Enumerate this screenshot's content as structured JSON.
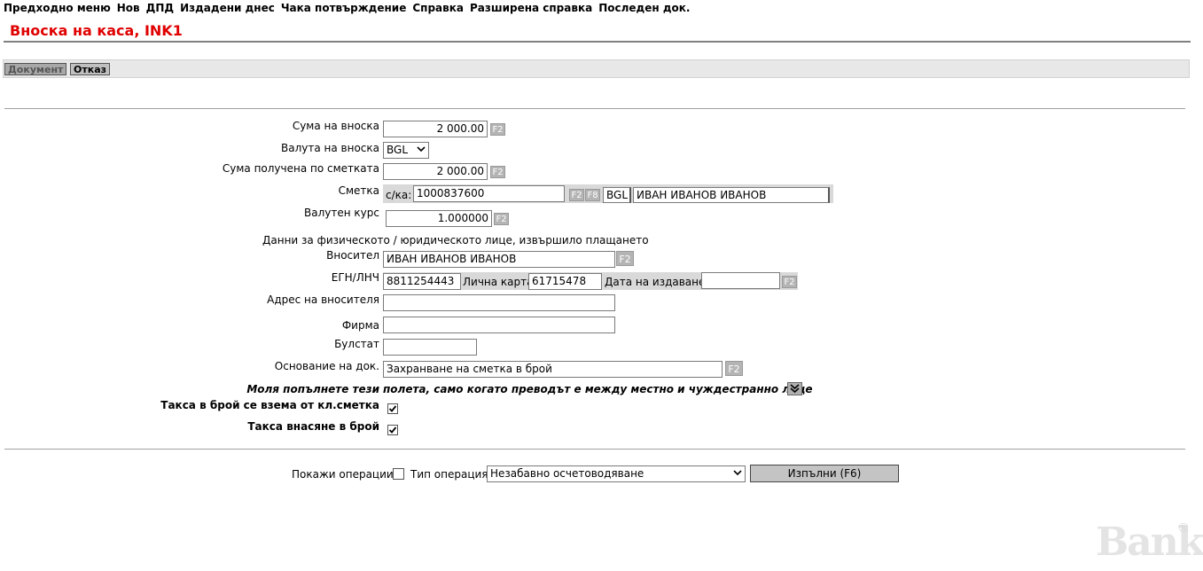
{
  "menu": [
    "Предходно меню",
    "Нов",
    "ДПД",
    "Издадени днес",
    "Чака потвърждение",
    "Справка",
    "Разширена справка",
    "Последен док."
  ],
  "title": "Вноска на каса, INK1",
  "tabs": {
    "document": "Документ",
    "cancel": "Отказ"
  },
  "form": {
    "amount_label": "Сума на вноска",
    "amount_value": "2 000.00",
    "currency_label": "Валута на вноска",
    "currency_value": "BGL",
    "received_label": "Сума получена по сметката",
    "received_value": "2 000.00",
    "account_label": "Сметка",
    "account_prefix": "с/ка:",
    "account_value": "1000837600",
    "account_currency": "BGL",
    "account_holder": "ИВАН ИВАНОВ ИВАНОВ",
    "rate_label": "Валутен курс",
    "rate_value": "1.000000",
    "person_section": "Данни за физическото / юридическото лице, извършило плащането",
    "depositor_label": "Вносител",
    "depositor_value": "ИВАН ИВАНОВ ИВАНОВ",
    "egn_label": "ЕГН/ЛНЧ",
    "egn_value": "8811254443",
    "id_card_label": "Лична карта",
    "id_card_value": "61715478",
    "issue_date_label": "Дата на издаване",
    "issue_date_value": "",
    "address_label": "Адрес на вносителя",
    "address_value": "",
    "company_label": "Фирма",
    "company_value": "",
    "bulstat_label": "Булстат",
    "bulstat_value": "",
    "basis_label": "Основание на док.",
    "basis_value": "Захранване на сметка в брой",
    "note_part1": "Моля попълнете тези",
    "note_part2": "полета, само когато преводът е между местно и чуждестранно лице",
    "fee_from_account_label": "Такса в брой се взема от кл.сметка",
    "fee_from_account_checked": true,
    "fee_cash_label": "Такса внасяне в брой",
    "fee_cash_checked": true
  },
  "fbtn": {
    "f2": "F2",
    "f8": "F8"
  },
  "footer": {
    "show_ops_label": "Покажи операции",
    "show_ops_checked": false,
    "op_type_label": "Тип операция",
    "op_type_value": "Незабавно осчетоводяване",
    "execute_label": "Изпълни (F6)"
  },
  "logo": {
    "text": "Banker",
    "mark": "®"
  }
}
